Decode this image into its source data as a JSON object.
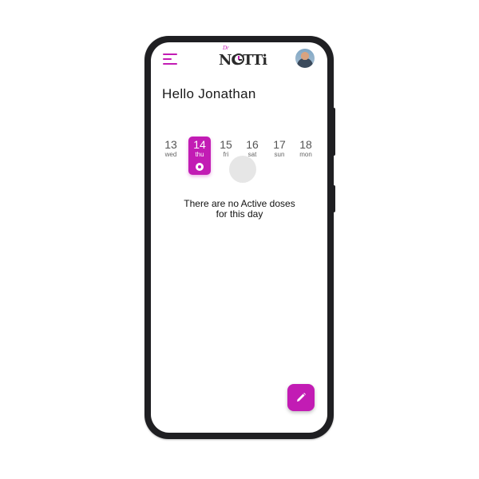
{
  "app": {
    "logo_prefix": "Dr",
    "logo_word": "NOTTi"
  },
  "greeting": "Hello Jonathan",
  "dates": [
    {
      "num": "13",
      "dow": "wed",
      "selected": false
    },
    {
      "num": "14",
      "dow": "thu",
      "selected": true
    },
    {
      "num": "15",
      "dow": "fri",
      "selected": false
    },
    {
      "num": "16",
      "dow": "sat",
      "selected": false
    },
    {
      "num": "17",
      "dow": "sun",
      "selected": false
    },
    {
      "num": "18",
      "dow": "mon",
      "selected": false
    }
  ],
  "empty_state": {
    "line1": "There are no Active doses",
    "line2": "for this day"
  },
  "icons": {
    "menu": "hamburger-menu-icon",
    "fab": "pencil-icon"
  },
  "colors": {
    "accent": "#c21cb4",
    "phone_frame": "#1f1f22"
  }
}
